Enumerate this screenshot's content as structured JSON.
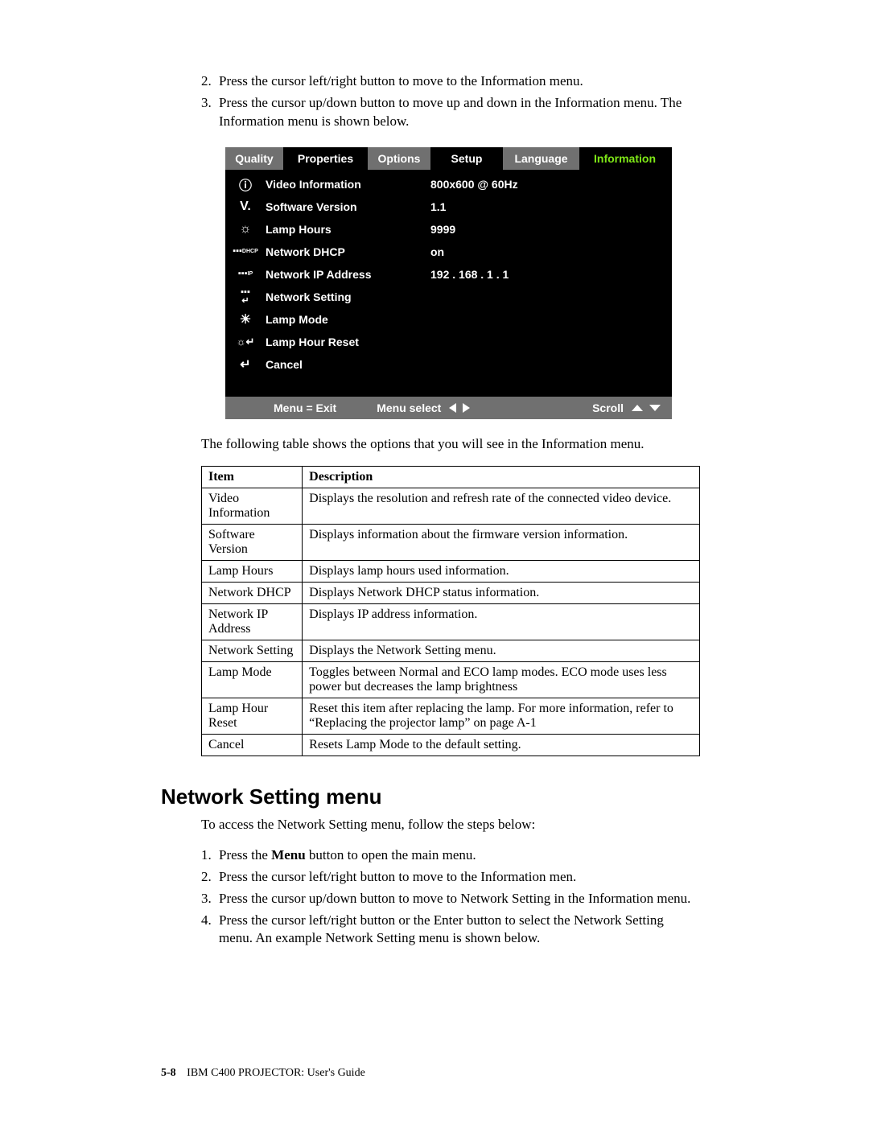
{
  "steps_top": [
    {
      "n": "2.",
      "t": "Press the cursor left/right button to move to the Information menu."
    },
    {
      "n": "3.",
      "t": "Press the cursor up/down button to move up and down in the Information menu. The Information menu is shown below."
    }
  ],
  "osd": {
    "tabs": [
      "Quality",
      "Properties",
      "Options",
      "Setup",
      "Language",
      "Information"
    ],
    "rows": [
      {
        "icon": "info-icon",
        "glyph": "ⓘ",
        "label": "Video Information",
        "value": "800x600 @ 60Hz"
      },
      {
        "icon": "version-icon",
        "glyph": "V.",
        "label": "Software Version",
        "value": "1.1"
      },
      {
        "icon": "lamp-icon",
        "glyph": "☼",
        "label": "Lamp Hours",
        "value": "9999"
      },
      {
        "icon": "dhcp-icon",
        "glyph": "DHCP",
        "label": "Network DHCP",
        "value": "on"
      },
      {
        "icon": "ip-icon",
        "glyph": "IP",
        "label": "Network IP Address",
        "value": "192 . 168 . 1 . 1"
      },
      {
        "icon": "net-setting-icon",
        "glyph": "⇄",
        "label": "Network Setting",
        "value": ""
      },
      {
        "icon": "lamp-mode-icon",
        "glyph": "☀",
        "label": "Lamp Mode",
        "value": ""
      },
      {
        "icon": "lamp-reset-icon",
        "glyph": "☼↵",
        "label": "Lamp Hour Reset",
        "value": ""
      },
      {
        "icon": "cancel-icon",
        "glyph": "↵",
        "label": "Cancel",
        "value": ""
      }
    ],
    "footer": {
      "exit": "Menu = Exit",
      "select": "Menu select",
      "scroll": "Scroll"
    }
  },
  "table_intro": "The following table shows the options that you will see in the Information menu.",
  "table": {
    "headers": [
      "Item",
      "Description"
    ],
    "rows": [
      [
        "Video Information",
        "Displays the resolution and refresh rate of the connected video device."
      ],
      [
        "Software Version",
        "Displays information about the firmware version information."
      ],
      [
        "Lamp Hours",
        "Displays lamp hours used information."
      ],
      [
        "Network DHCP",
        "Displays Network DHCP status information."
      ],
      [
        "Network IP Address",
        "Displays IP address information."
      ],
      [
        "Network Setting",
        "Displays the Network Setting menu."
      ],
      [
        "Lamp Mode",
        "Toggles between Normal and ECO lamp modes. ECO mode uses less power but decreases the lamp brightness"
      ],
      [
        "Lamp Hour Reset",
        "Reset this item after replacing the lamp. For more information, refer to “Replacing the projector lamp” on page A-1"
      ],
      [
        "Cancel",
        "Resets Lamp Mode to the default setting."
      ]
    ]
  },
  "section_heading": "Network Setting menu",
  "section_intro": "To access the Network Setting menu, follow the steps below:",
  "steps_bottom": [
    {
      "n": "1.",
      "pre": "Press the ",
      "b": "Menu",
      "post": " button to open the main menu."
    },
    {
      "n": "2.",
      "t": "Press the cursor left/right button to move to the Information men."
    },
    {
      "n": "3.",
      "t": "Press the cursor up/down button to move to Network Setting in the Information menu."
    },
    {
      "n": "4.",
      "t": "Press the cursor left/right button or the Enter button to select the Network Setting menu. An example Network Setting menu is shown below."
    }
  ],
  "footer": {
    "page": "5-8",
    "title": "IBM C400 PROJECTOR: User's Guide"
  }
}
